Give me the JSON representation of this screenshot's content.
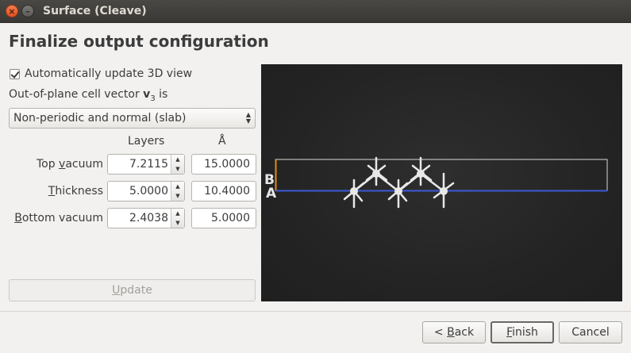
{
  "window": {
    "title": "Surface (Cleave)",
    "close_glyph": "×",
    "minimize_glyph": "–"
  },
  "heading": "Finalize output configuration",
  "auto_update": {
    "label": "Automatically update 3D view",
    "checked": true
  },
  "cell_vector": {
    "prefix": "Out-of-plane cell vector ",
    "symbol": "v",
    "subscript": "3",
    "suffix": " is"
  },
  "combo": {
    "value": "Non-periodic and normal (slab)"
  },
  "table": {
    "col_layers": "Layers",
    "col_angstrom": "Å",
    "rows": [
      {
        "label_pre": "Top ",
        "mnemonic": "v",
        "label_post": "acuum",
        "layers": "7.2115",
        "angstrom": "15.0000"
      },
      {
        "label_pre": "",
        "mnemonic": "T",
        "label_post": "hickness",
        "layers": "5.0000",
        "angstrom": "10.4000"
      },
      {
        "label_pre": "",
        "mnemonic": "B",
        "label_post": "ottom vacuum",
        "layers": "2.4038",
        "angstrom": "5.0000"
      }
    ]
  },
  "update_button": {
    "mnemonic": "U",
    "rest": "pdate"
  },
  "viewport": {
    "label_b": "B",
    "label_a": "A",
    "background": "#262626",
    "cell_color": "#d9d9d9",
    "vector_a_color": "#3a5ad6",
    "vector_b_color": "#e08a1e",
    "atom_color": "#e8e8e8"
  },
  "buttons": {
    "back": {
      "prefix": "< ",
      "mnemonic": "B",
      "rest": "ack"
    },
    "finish": {
      "mnemonic": "F",
      "rest": "inish"
    },
    "cancel": "Cancel"
  }
}
